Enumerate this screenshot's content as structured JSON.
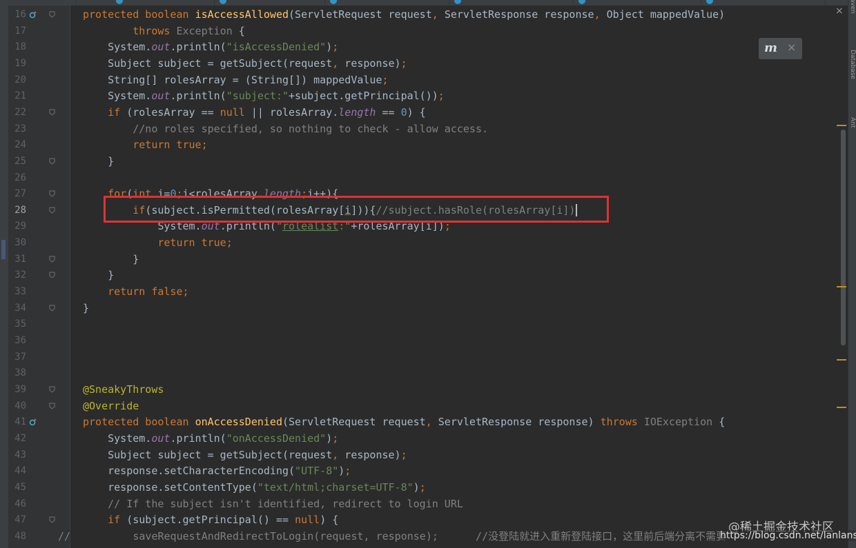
{
  "editor": {
    "lines": [
      {
        "n": "16",
        "html": "<span class=\"kw\">protected boolean </span><span class=\"fn\">isAccessAllowed</span>(ServletRequest request<span class=\"kw\">, </span>ServletResponse response<span class=\"kw\">, </span>Object mappedValue)"
      },
      {
        "n": "17",
        "html": "        <span class=\"kw\">throws </span><span class=\"ex\">Exception </span>{"
      },
      {
        "n": "18",
        "html": "    System.<span class=\"ital\">out</span>.println(<span class=\"st\">\"isAccessDenied\"</span>)<span class=\"kw\">;</span>"
      },
      {
        "n": "19",
        "html": "    Subject subject = getSubject(request<span class=\"kw\">, </span>response)<span class=\"kw\">;</span>"
      },
      {
        "n": "20",
        "html": "    String[] rolesArray = (String[]) mappedValue<span class=\"kw\">;</span>"
      },
      {
        "n": "21",
        "html": "    System.<span class=\"ital\">out</span>.println(<span class=\"st\">\"subject:\"</span>+subject.getPrincipal())<span class=\"kw\">;</span>"
      },
      {
        "n": "22",
        "html": "    <span class=\"kw\">if </span>(rolesArray == <span class=\"kw\">null </span>|| rolesArray.<span class=\"ital\">length </span>== <span class=\"num\">0</span>) {"
      },
      {
        "n": "23",
        "html": "        <span class=\"cm\">//no roles specified, so nothing to check - allow access.</span>"
      },
      {
        "n": "24",
        "html": "        <span class=\"kw\">return true;</span>"
      },
      {
        "n": "25",
        "html": "    }"
      },
      {
        "n": "26",
        "html": ""
      },
      {
        "n": "27",
        "html": "    <span class=\"kw\">for</span>(<span class=\"kw\">int </span>i=<span class=\"num\">0</span><span class=\"kw\">;</span>i&lt;rolesArray.<span class=\"ital\">length</span><span class=\"kw\">;</span>i++){"
      },
      {
        "n": "28",
        "html": "        <span class=\"kw\">if</span>(subject.isPermitted(rolesArray[<span class=\"ul\">i</span>])){<span class=\"cm\">//subject.hasRole(rolesArray[i])</span><span class=\"caret\"></span>"
      },
      {
        "n": "29",
        "html": "            System.<span class=\"ital\">out</span>.println(<span class=\"st\">\"<span class=\"ul\">rolealist</span>:\"</span>+rolesArray[i])<span class=\"kw\">;</span>"
      },
      {
        "n": "30",
        "html": "            <span class=\"kw\">return true;</span>"
      },
      {
        "n": "31",
        "html": "        }"
      },
      {
        "n": "32",
        "html": "    }"
      },
      {
        "n": "33",
        "html": "    <span class=\"kw\">return false;</span>"
      },
      {
        "n": "34",
        "html": "}"
      },
      {
        "n": "35",
        "html": ""
      },
      {
        "n": "36",
        "html": ""
      },
      {
        "n": "37",
        "html": ""
      },
      {
        "n": "38",
        "html": ""
      },
      {
        "n": "39",
        "html": "<span class=\"ann\">@SneakyThrows</span>"
      },
      {
        "n": "40",
        "html": "<span class=\"ann\">@Override</span>"
      },
      {
        "n": "41",
        "html": "<span class=\"kw\">protected boolean </span><span class=\"fn\">onAccessDenied</span>(ServletRequest request<span class=\"kw\">, </span>ServletResponse response) <span class=\"kw\">throws </span><span class=\"ex\">IOException </span>{"
      },
      {
        "n": "42",
        "html": "    System.<span class=\"ital\">out</span>.println(<span class=\"st\">\"onAccessDenied\"</span>)<span class=\"kw\">;</span>"
      },
      {
        "n": "43",
        "html": "    Subject subject = getSubject(request<span class=\"kw\">, </span>response)<span class=\"kw\">;</span>"
      },
      {
        "n": "44",
        "html": "    response.setCharacterEncoding(<span class=\"st\">\"UTF-8\"</span>)<span class=\"kw\">;</span>"
      },
      {
        "n": "45",
        "html": "    response.setContentType(<span class=\"st\">\"text/html;charset=UTF-8\"</span>)<span class=\"kw\">;</span>"
      },
      {
        "n": "46",
        "html": "    <span class=\"cm\">// If the subject isn't identified, redirect to login URL</span>"
      },
      {
        "n": "47",
        "html": "    <span class=\"kw\">if </span>(subject.getPrincipal() == <span class=\"kw\">null</span>) {"
      },
      {
        "n": "48",
        "html": "<span class=\"cm\">//          saveRequestAndRedirectToLogin(request, response);      //没登陆就进入重新登陆接口，这里前后端分离不需要</span>"
      }
    ],
    "current_line": "28"
  },
  "right_panel": {
    "tabs": [
      "Maven",
      "Database",
      "Ant"
    ]
  },
  "hint_popup": {
    "logo": "m",
    "close": "×"
  },
  "top_close": "×",
  "watermark": {
    "cn": "@稀土掘金技术社区",
    "url": "https://blog.csdn.net/lanlansir"
  },
  "colors": {
    "keyword": "#cc7832",
    "method": "#ffc66d",
    "string": "#6a8759",
    "number": "#6897bb",
    "comment": "#808080",
    "field": "#9876aa",
    "annotation": "#bbb529",
    "highlight_box": "#e03232"
  }
}
